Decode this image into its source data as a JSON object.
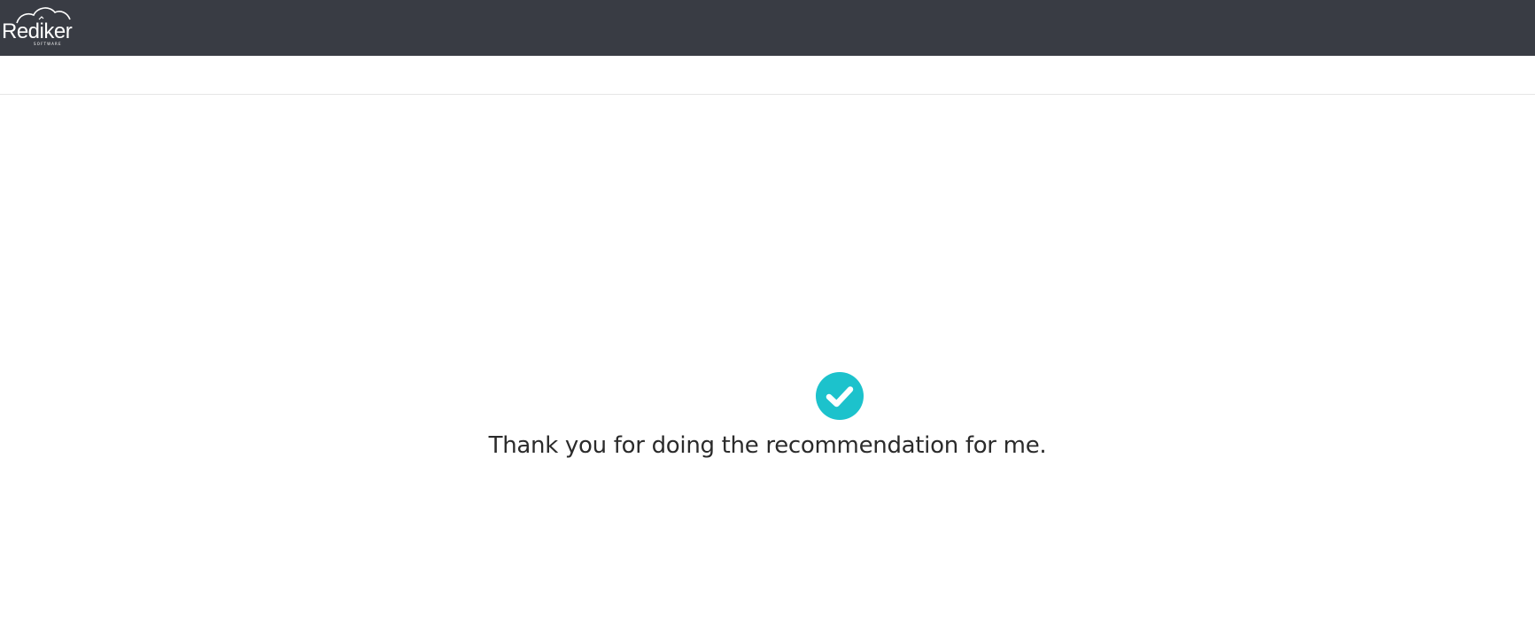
{
  "header": {
    "logo_text": "Rediker",
    "logo_subtext": "SOFTWARE",
    "background_color": "#393c44"
  },
  "confirmation": {
    "icon": "check-circle-icon",
    "icon_color": "#1cc2cc",
    "message": "Thank you for doing the recommendation for me."
  }
}
